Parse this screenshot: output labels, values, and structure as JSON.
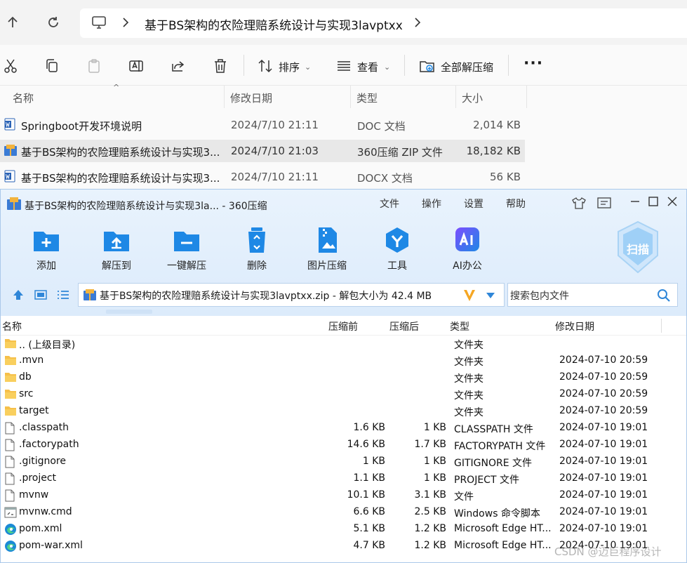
{
  "explorer": {
    "breadcrumb": "基于BS架构的农险理赔系统设计与实现3lavptxx",
    "toolbar": {
      "sort": "排序",
      "view": "查看",
      "extract_all": "全部解压缩"
    },
    "columns": {
      "name": "名称",
      "date": "修改日期",
      "type": "类型",
      "size": "大小"
    },
    "files": [
      {
        "name": "Springboot开发环境说明",
        "date": "2024/7/10 21:11",
        "type": "DOC 文档",
        "size": "2,014 KB",
        "icon": "word-doc-icon"
      },
      {
        "name": "基于BS架构的农险理赔系统设计与实现3...",
        "date": "2024/7/10 21:03",
        "type": "360压缩 ZIP 文件",
        "size": "18,182 KB",
        "icon": "zip-archive-icon",
        "selected": true
      },
      {
        "name": "基于BS架构的农险理赔系统设计与实现3...",
        "date": "2024/7/10 21:11",
        "type": "DOCX 文档",
        "size": "56 KB",
        "icon": "word-doc-icon"
      }
    ]
  },
  "zip": {
    "title": "基于BS架构的农险理赔系统设计与实现3la... - 360压缩",
    "menu": {
      "file": "文件",
      "ops": "操作",
      "settings": "设置",
      "help": "帮助"
    },
    "toolbar": {
      "add": "添加",
      "extract_to": "解压到",
      "one_click": "一键解压",
      "delete": "删除",
      "image_compress": "图片压缩",
      "tools": "工具",
      "ai": "AI办公",
      "scan": "扫描"
    },
    "path": "基于BS架构的农险理赔系统设计与实现3lavptxx.zip - 解包大小为 42.4 MB",
    "search_placeholder": "搜索包内文件",
    "columns": {
      "name": "名称",
      "before": "压缩前",
      "after": "压缩后",
      "type": "类型",
      "date": "修改日期"
    },
    "rows": [
      {
        "name": ".. (上级目录)",
        "before": "",
        "after": "",
        "type": "文件夹",
        "date": "",
        "icon": "folder-icon"
      },
      {
        "name": ".mvn",
        "before": "",
        "after": "",
        "type": "文件夹",
        "date": "2024-07-10 20:59",
        "icon": "folder-icon"
      },
      {
        "name": "db",
        "before": "",
        "after": "",
        "type": "文件夹",
        "date": "2024-07-10 20:59",
        "icon": "folder-icon"
      },
      {
        "name": "src",
        "before": "",
        "after": "",
        "type": "文件夹",
        "date": "2024-07-10 20:59",
        "icon": "folder-icon"
      },
      {
        "name": "target",
        "before": "",
        "after": "",
        "type": "文件夹",
        "date": "2024-07-10 20:59",
        "icon": "folder-icon"
      },
      {
        "name": ".classpath",
        "before": "1.6 KB",
        "after": "1 KB",
        "type": "CLASSPATH 文件",
        "date": "2024-07-10 19:01",
        "icon": "file-icon"
      },
      {
        "name": ".factorypath",
        "before": "14.6 KB",
        "after": "1.7 KB",
        "type": "FACTORYPATH 文件",
        "date": "2024-07-10 19:01",
        "icon": "file-icon"
      },
      {
        "name": ".gitignore",
        "before": "1 KB",
        "after": "1 KB",
        "type": "GITIGNORE 文件",
        "date": "2024-07-10 19:01",
        "icon": "file-icon"
      },
      {
        "name": ".project",
        "before": "1.1 KB",
        "after": "1 KB",
        "type": "PROJECT 文件",
        "date": "2024-07-10 19:01",
        "icon": "file-icon"
      },
      {
        "name": "mvnw",
        "before": "10.1 KB",
        "after": "3.1 KB",
        "type": "文件",
        "date": "2024-07-10 19:01",
        "icon": "file-icon"
      },
      {
        "name": "mvnw.cmd",
        "before": "6.6 KB",
        "after": "2.5 KB",
        "type": "Windows 命令脚本",
        "date": "2024-07-10 19:01",
        "icon": "cmd-script-icon"
      },
      {
        "name": "pom.xml",
        "before": "5.1 KB",
        "after": "1.2 KB",
        "type": "Microsoft Edge HT...",
        "date": "2024-07-10 19:01",
        "icon": "edge-icon"
      },
      {
        "name": "pom-war.xml",
        "before": "4.7 KB",
        "after": "1.2 KB",
        "type": "Microsoft Edge HT...",
        "date": "2024-07-10 19:01",
        "icon": "edge-icon"
      }
    ]
  },
  "watermark": "CSDN @迈巨程序设计",
  "colors": {
    "accent": "#1e88e5",
    "zip_title_bg": "#e9f3fd",
    "selection": "#e8e8e8"
  }
}
